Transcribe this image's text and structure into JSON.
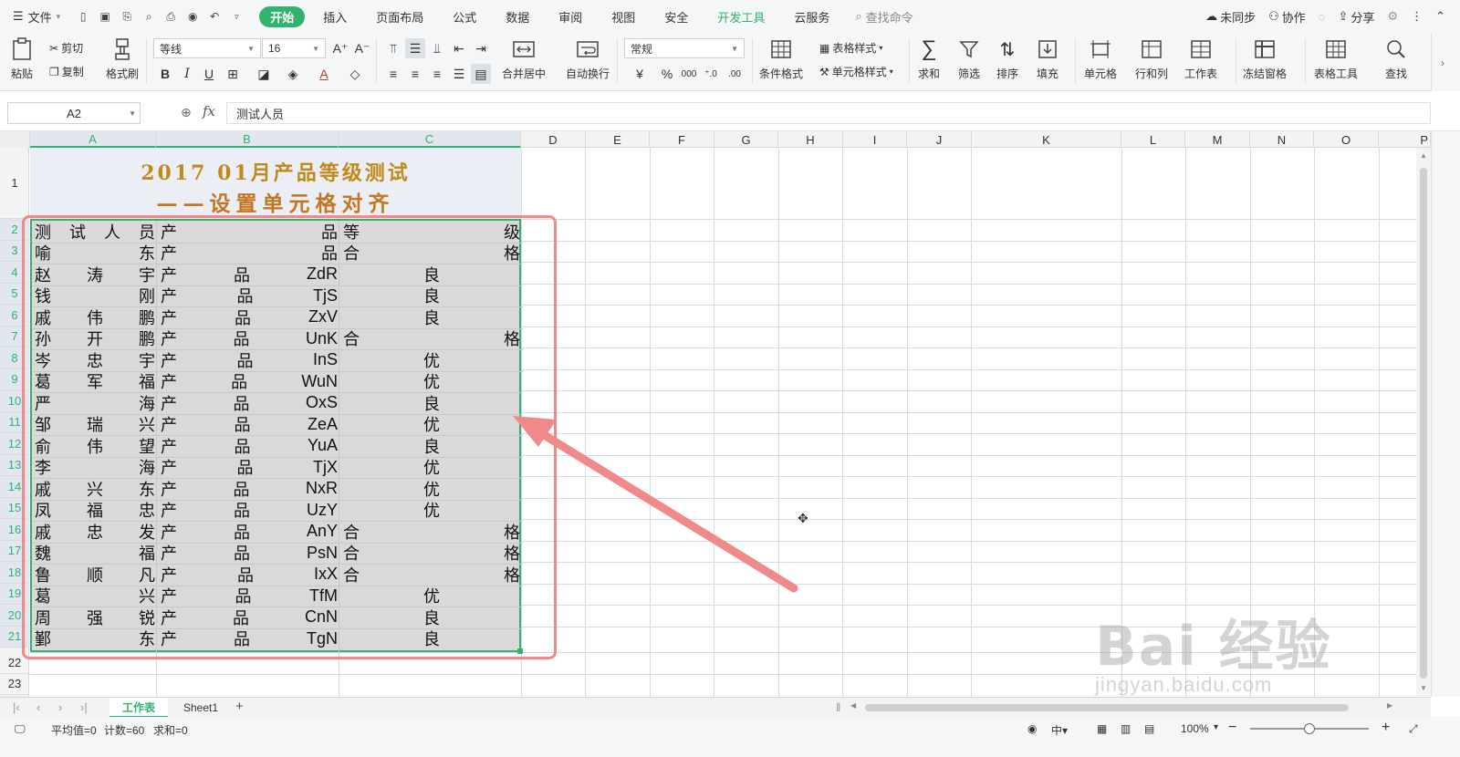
{
  "menubar": {
    "file_label": "文件",
    "tabs": [
      "开始",
      "插入",
      "页面布局",
      "公式",
      "数据",
      "审阅",
      "视图",
      "安全",
      "开发工具",
      "云服务"
    ],
    "search_label": "查找命令",
    "right": {
      "sync": "未同步",
      "collab": "协作",
      "share": "分享"
    }
  },
  "ribbon": {
    "paste": "粘贴",
    "cut": "剪切",
    "copy": "复制",
    "format_painter": "格式刷",
    "font_name": "等线",
    "font_size": "16",
    "bold": "B",
    "italic": "I",
    "underline": "U",
    "merge_center": "合并居中",
    "wrap_text": "自动换行",
    "number_format": "常规",
    "cond_format": "条件格式",
    "table_style": "表格样式",
    "cell_style": "单元格样式",
    "sum": "求和",
    "filter": "筛选",
    "sort": "排序",
    "fill": "填充",
    "cells": "单元格",
    "rows_cols": "行和列",
    "worksheet": "工作表",
    "freeze": "冻结窗格",
    "table_tools": "表格工具",
    "find": "查找"
  },
  "formula_bar": {
    "name_box": "A2",
    "fx": "fx",
    "content": "测试人员"
  },
  "columns": [
    "A",
    "B",
    "C",
    "D",
    "E",
    "F",
    "G",
    "H",
    "I",
    "J",
    "K",
    "L",
    "M",
    "N",
    "O",
    "P"
  ],
  "rows": [
    "1",
    "2",
    "3",
    "4",
    "5",
    "6",
    "7",
    "8",
    "9",
    "10",
    "11",
    "12",
    "13",
    "14",
    "15",
    "16",
    "17",
    "18",
    "19",
    "20",
    "21",
    "22",
    "23"
  ],
  "sheet": {
    "title_line1": "2017 01月产品等级测试",
    "title_line2": "——设置单元格对齐",
    "header": {
      "tester": "测试人员",
      "product": "产品",
      "grade": "等级"
    },
    "data": [
      {
        "tester": "喻东",
        "product": "产品",
        "grade": "合格"
      },
      {
        "tester": "赵涛宇",
        "product": "产品ZdR",
        "grade": "良"
      },
      {
        "tester": "钱刚",
        "product": "产品TjS",
        "grade": "良"
      },
      {
        "tester": "戚伟鹏",
        "product": "产品ZxV",
        "grade": "良"
      },
      {
        "tester": "孙开鹏",
        "product": "产品UnK",
        "grade": "合格"
      },
      {
        "tester": "岑忠宇",
        "product": "产品InS",
        "grade": "优"
      },
      {
        "tester": "葛军福",
        "product": "产品WuN",
        "grade": "优"
      },
      {
        "tester": "严海",
        "product": "产品OxS",
        "grade": "良"
      },
      {
        "tester": "邹瑞兴",
        "product": "产品ZeA",
        "grade": "优"
      },
      {
        "tester": "俞伟望",
        "product": "产品YuA",
        "grade": "良"
      },
      {
        "tester": "李海",
        "product": "产品TjX",
        "grade": "优"
      },
      {
        "tester": "戚兴东",
        "product": "产品NxR",
        "grade": "优"
      },
      {
        "tester": "凤福忠",
        "product": "产品UzY",
        "grade": "优"
      },
      {
        "tester": "戚忠发",
        "product": "产品AnY",
        "grade": "合格"
      },
      {
        "tester": "魏福",
        "product": "产品PsN",
        "grade": "合格"
      },
      {
        "tester": "鲁顺凡",
        "product": "产品IxX",
        "grade": "合格"
      },
      {
        "tester": "葛兴",
        "product": "产品TfM",
        "grade": "优"
      },
      {
        "tester": "周强锐",
        "product": "产品CnN",
        "grade": "良"
      },
      {
        "tester": "鄞东",
        "product": "产品TgN",
        "grade": "良"
      }
    ]
  },
  "sheet_tabs": [
    "工作表",
    "Sheet1"
  ],
  "status": {
    "average": "平均值=0",
    "count": "计数=60",
    "sum": "求和=0",
    "zoom": "100%",
    "zoom_level": 0.5
  },
  "watermark": {
    "main": "Bai 经验",
    "url": "jingyan.baidu.com"
  },
  "colors": {
    "accent": "#2fb36f",
    "selection_fill": "#d9d9d9",
    "annotation": "#f08a8a",
    "title": "#c08a1a"
  }
}
